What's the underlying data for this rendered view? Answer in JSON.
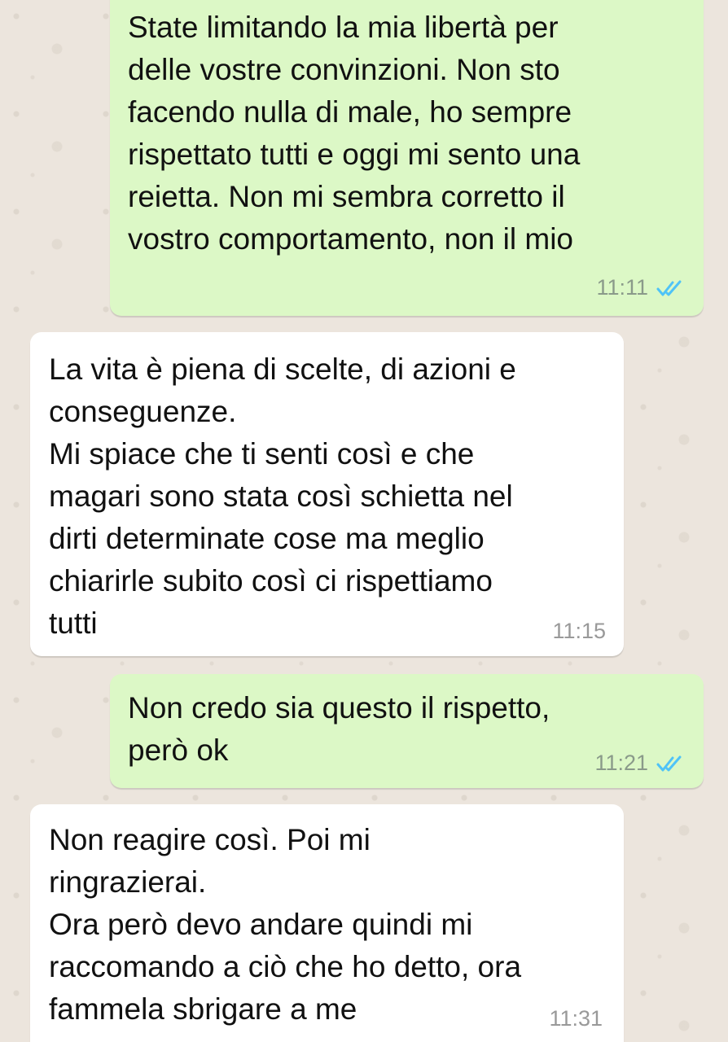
{
  "messages": [
    {
      "direction": "outgoing",
      "text": "State limitando la mia libertà per\ndelle vostre convinzioni. Non sto\nfacendo nulla di male, ho sempre\nrispettato tutti e oggi mi sento una\nreietta. Non mi sembra corretto il\nvostro comportamento, non il mio",
      "time": "11:11",
      "status_icon": "double-check-read-icon"
    },
    {
      "direction": "incoming",
      "text": "La vita è piena di scelte, di azioni e\nconseguenze.\nMi spiace che ti senti così e che\nmagari sono stata così schietta nel\ndirti determinate cose ma meglio\nchiarirle subito così ci rispettiamo\ntutti",
      "time": "11:15"
    },
    {
      "direction": "outgoing",
      "text": "Non credo sia questo il rispetto,\nperò ok",
      "time": "11:21",
      "status_icon": "double-check-read-icon"
    },
    {
      "direction": "incoming",
      "text": "Non reagire così. Poi mi\nringrazierai.\nOra però devo andare quindi mi\nraccomando a ciò che ho detto, ora\nfammela sbrigare a me",
      "time": "11:31"
    }
  ],
  "colors": {
    "wallpaper": "#ece5dd",
    "outgoing_bubble": "#dcf8c6",
    "incoming_bubble": "#ffffff",
    "read_ticks": "#4fc3f7"
  }
}
